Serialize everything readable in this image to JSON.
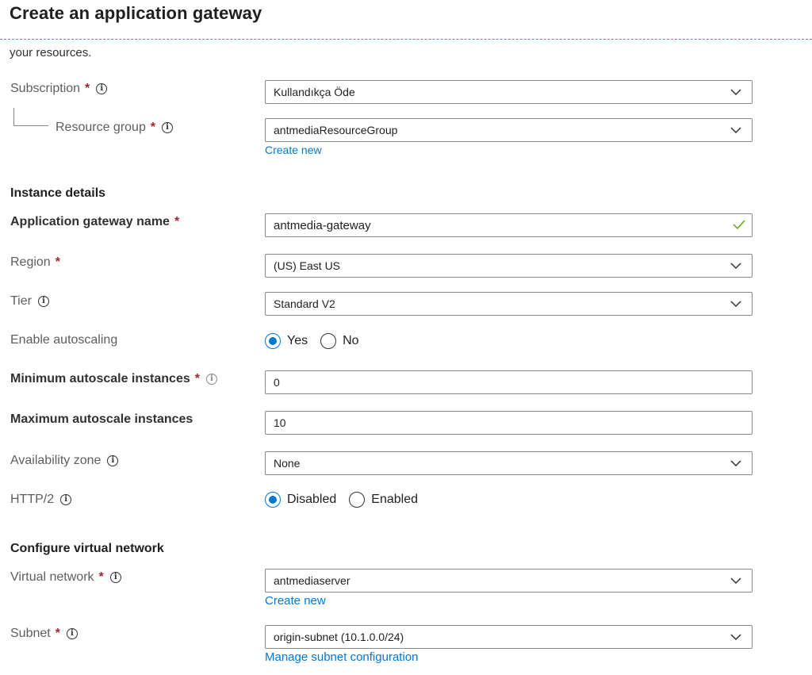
{
  "header": {
    "title": "Create an application gateway"
  },
  "intro_text": "your resources.",
  "project": {
    "subscription": {
      "label": "Subscription",
      "value": "Kullandıkça Öde"
    },
    "resource_group": {
      "label": "Resource group",
      "value": "antmediaResourceGroup",
      "create_new": "Create new"
    }
  },
  "instance": {
    "heading": "Instance details",
    "gateway_name": {
      "label": "Application gateway name",
      "value": "antmedia-gateway"
    },
    "region": {
      "label": "Region",
      "value": "(US) East US"
    },
    "tier": {
      "label": "Tier",
      "value": "Standard V2"
    },
    "autoscaling": {
      "label": "Enable autoscaling",
      "options": [
        "Yes",
        "No"
      ],
      "selected": "Yes"
    },
    "min_instances": {
      "label": "Minimum autoscale instances",
      "value": "0"
    },
    "max_instances": {
      "label": "Maximum autoscale instances",
      "value": "10"
    },
    "availability_zone": {
      "label": "Availability zone",
      "value": "None"
    },
    "http2": {
      "label": "HTTP/2",
      "options": [
        "Disabled",
        "Enabled"
      ],
      "selected": "Disabled"
    }
  },
  "network": {
    "heading": "Configure virtual network",
    "virtual_network": {
      "label": "Virtual network",
      "value": "antmediaserver",
      "create_new": "Create new"
    },
    "subnet": {
      "label": "Subnet",
      "value": "origin-subnet (10.1.0.0/24)",
      "manage": "Manage subnet configuration"
    }
  },
  "required_marker": "*",
  "info_glyph": "i",
  "colors": {
    "accent": "#0078d4",
    "required": "#a4262c",
    "valid": "#57a300",
    "divider": "#1fa3c9"
  },
  "icons": {
    "info": "info-icon",
    "dropdown": "chevron-down-icon",
    "valid": "checkmark-icon"
  }
}
